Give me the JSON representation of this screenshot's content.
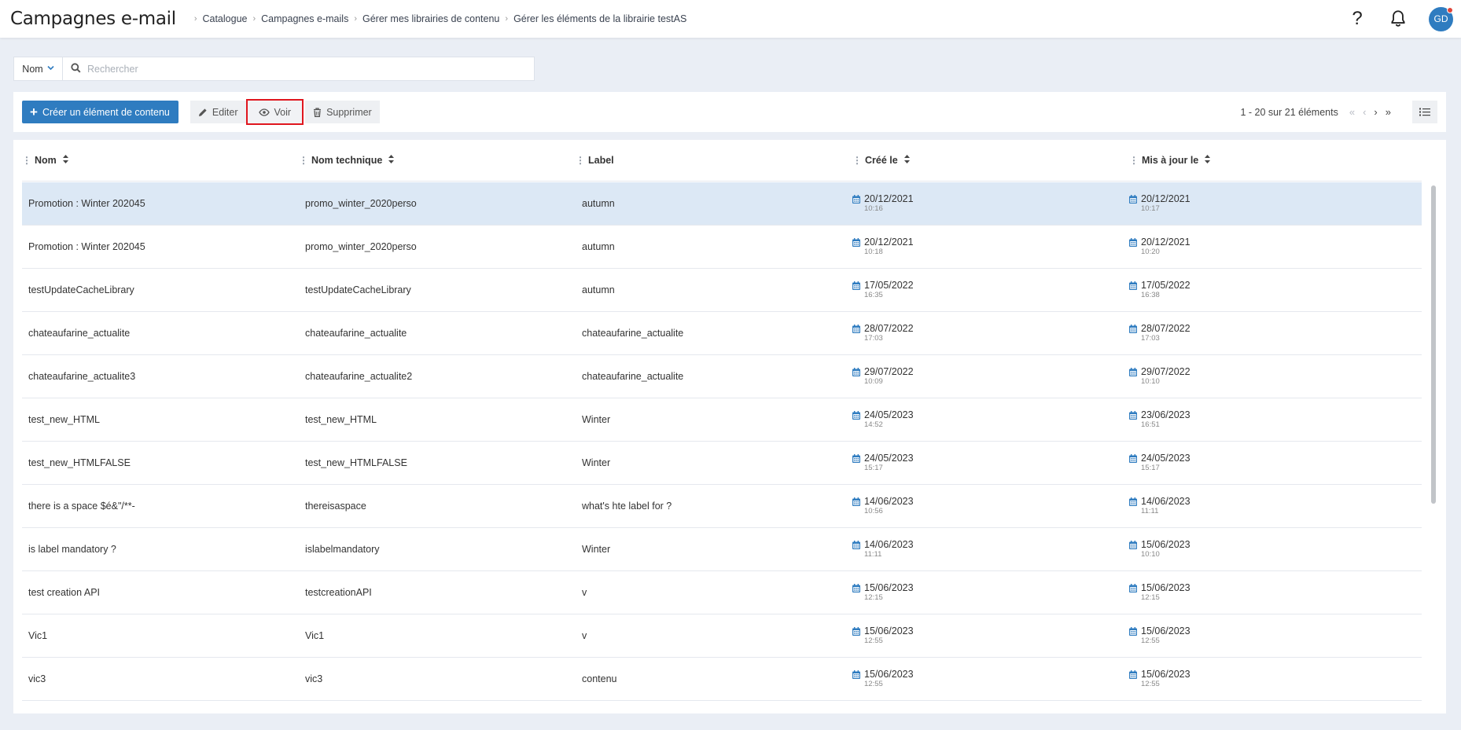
{
  "header": {
    "app_title": "Campagnes e-mail",
    "breadcrumb": [
      "Catalogue",
      "Campagnes e-mails",
      "Gérer mes librairies de contenu",
      "Gérer les éléments de la librairie testAS"
    ],
    "help_label": "?",
    "avatar_initials": "GD"
  },
  "search": {
    "field_selected": "Nom",
    "placeholder": "Rechercher",
    "value": ""
  },
  "toolbar": {
    "create_label": "Créer un élément de contenu",
    "edit_label": "Editer",
    "view_label": "Voir",
    "delete_label": "Supprimer",
    "pagination_info": "1 - 20 sur 21 éléments"
  },
  "colors": {
    "accent": "#2f7cc0",
    "selected_row": "#dce8f5",
    "highlight_border": "#e0161e"
  },
  "table": {
    "columns": [
      "Nom",
      "Nom technique",
      "Label",
      "Créé le",
      "Mis à jour le"
    ],
    "rows": [
      {
        "name": "Promotion : Winter 202045",
        "technical": "promo_winter_2020perso",
        "label": "autumn",
        "created_date": "20/12/2021",
        "created_time": "10:16",
        "updated_date": "20/12/2021",
        "updated_time": "10:17"
      },
      {
        "name": "Promotion : Winter 202045",
        "technical": "promo_winter_2020perso",
        "label": "autumn",
        "created_date": "20/12/2021",
        "created_time": "10:18",
        "updated_date": "20/12/2021",
        "updated_time": "10:20"
      },
      {
        "name": "testUpdateCacheLibrary",
        "technical": "testUpdateCacheLibrary",
        "label": "autumn",
        "created_date": "17/05/2022",
        "created_time": "16:35",
        "updated_date": "17/05/2022",
        "updated_time": "16:38"
      },
      {
        "name": "chateaufarine_actualite",
        "technical": "chateaufarine_actualite",
        "label": "chateaufarine_actualite",
        "created_date": "28/07/2022",
        "created_time": "17:03",
        "updated_date": "28/07/2022",
        "updated_time": "17:03"
      },
      {
        "name": "chateaufarine_actualite3",
        "technical": "chateaufarine_actualite2",
        "label": "chateaufarine_actualite",
        "created_date": "29/07/2022",
        "created_time": "10:09",
        "updated_date": "29/07/2022",
        "updated_time": "10:10"
      },
      {
        "name": "test_new_HTML",
        "technical": "test_new_HTML",
        "label": "Winter",
        "created_date": "24/05/2023",
        "created_time": "14:52",
        "updated_date": "23/06/2023",
        "updated_time": "16:51"
      },
      {
        "name": "test_new_HTMLFALSE",
        "technical": "test_new_HTMLFALSE",
        "label": "Winter",
        "created_date": "24/05/2023",
        "created_time": "15:17",
        "updated_date": "24/05/2023",
        "updated_time": "15:17"
      },
      {
        "name": "there is a space $é&\"/**-",
        "technical": "thereisaspace",
        "label": "what's hte label for ?",
        "created_date": "14/06/2023",
        "created_time": "10:56",
        "updated_date": "14/06/2023",
        "updated_time": "11:11"
      },
      {
        "name": "is label mandatory ?",
        "technical": "islabelmandatory",
        "label": "Winter",
        "created_date": "14/06/2023",
        "created_time": "11:11",
        "updated_date": "15/06/2023",
        "updated_time": "10:10"
      },
      {
        "name": "test creation API",
        "technical": "testcreationAPI",
        "label": "v",
        "created_date": "15/06/2023",
        "created_time": "12:15",
        "updated_date": "15/06/2023",
        "updated_time": "12:15"
      },
      {
        "name": "Vic1",
        "technical": "Vic1",
        "label": "v",
        "created_date": "15/06/2023",
        "created_time": "12:55",
        "updated_date": "15/06/2023",
        "updated_time": "12:55"
      },
      {
        "name": "vic3",
        "technical": "vic3",
        "label": "contenu",
        "created_date": "15/06/2023",
        "created_time": "12:55",
        "updated_date": "15/06/2023",
        "updated_time": "12:55"
      }
    ]
  }
}
